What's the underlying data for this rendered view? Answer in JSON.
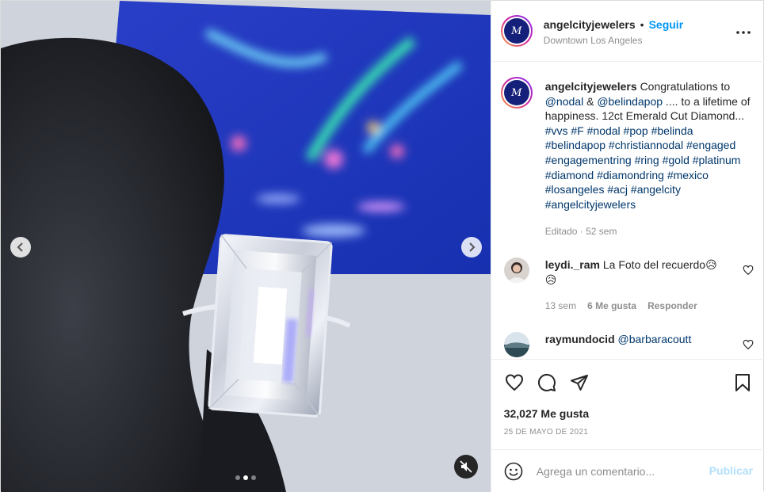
{
  "post": {
    "username": "angelcityjewelers",
    "follow_label": "Seguir",
    "location": "Downtown Los Angeles",
    "avatar_monogram": "M"
  },
  "caption": {
    "username": "angelcityjewelers",
    "text_1": "Congratulations to ",
    "mention_1": "@nodal",
    "text_2": " & ",
    "mention_2": "@belindapop",
    "text_3": " .... to a lifetime of happiness. 12ct Emerald Cut Diamond... ",
    "hashtags": "#vvs #F #nodal #pop #belinda #belindapop #christiannodal #engaged #engagementring #ring #gold #platinum #diamond #diamondring #mexico #losangeles #acj #angelcity #angelcityjewelers",
    "meta": "Editado · 52 sem"
  },
  "comments": [
    {
      "username": "leydi._ram",
      "text": "La Foto del recuerdo",
      "emoji": "😥",
      "emoji_2": "😥",
      "time": "13 sem",
      "likes": "6 Me gusta",
      "reply_label": "Responder"
    },
    {
      "username": "raymundocid",
      "text": "@barbaracoutt"
    }
  ],
  "actions": {
    "likes": "32,027 Me gusta",
    "date": "25 DE MAYO DE 2021"
  },
  "add_comment": {
    "placeholder": "Agrega un comentario...",
    "publish_label": "Publicar"
  },
  "colors": {
    "link": "#0095f6",
    "hashtag": "#00376b",
    "muted": "#8e8e8e",
    "publish_disabled": "#b2dffc"
  }
}
